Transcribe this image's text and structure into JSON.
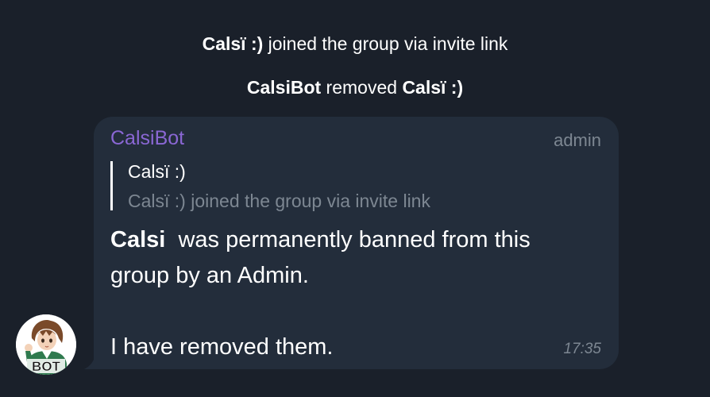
{
  "service_messages": [
    {
      "bold": "Calsï :)",
      "text": " joined the group via invite link"
    },
    {
      "bold": "CalsiBot",
      "text": " removed ",
      "bold2": "Calsï :)"
    }
  ],
  "message": {
    "sender": "CalsiBot",
    "badge": "admin",
    "reply": {
      "author": "Calsï :)",
      "text": "Calsï :) joined the group via invite link"
    },
    "body": {
      "bold_name": "Calsi",
      "line1_rest": "  was permanently banned from this",
      "line2": "group by an Admin.",
      "line3": "",
      "line4": "I have removed them."
    },
    "time": "17:35"
  },
  "avatar": {
    "label": "BOT"
  },
  "colors": {
    "background": "#1a202a",
    "bubble": "#232d3b",
    "sender": "#8a67d4",
    "muted": "#7d8792"
  }
}
